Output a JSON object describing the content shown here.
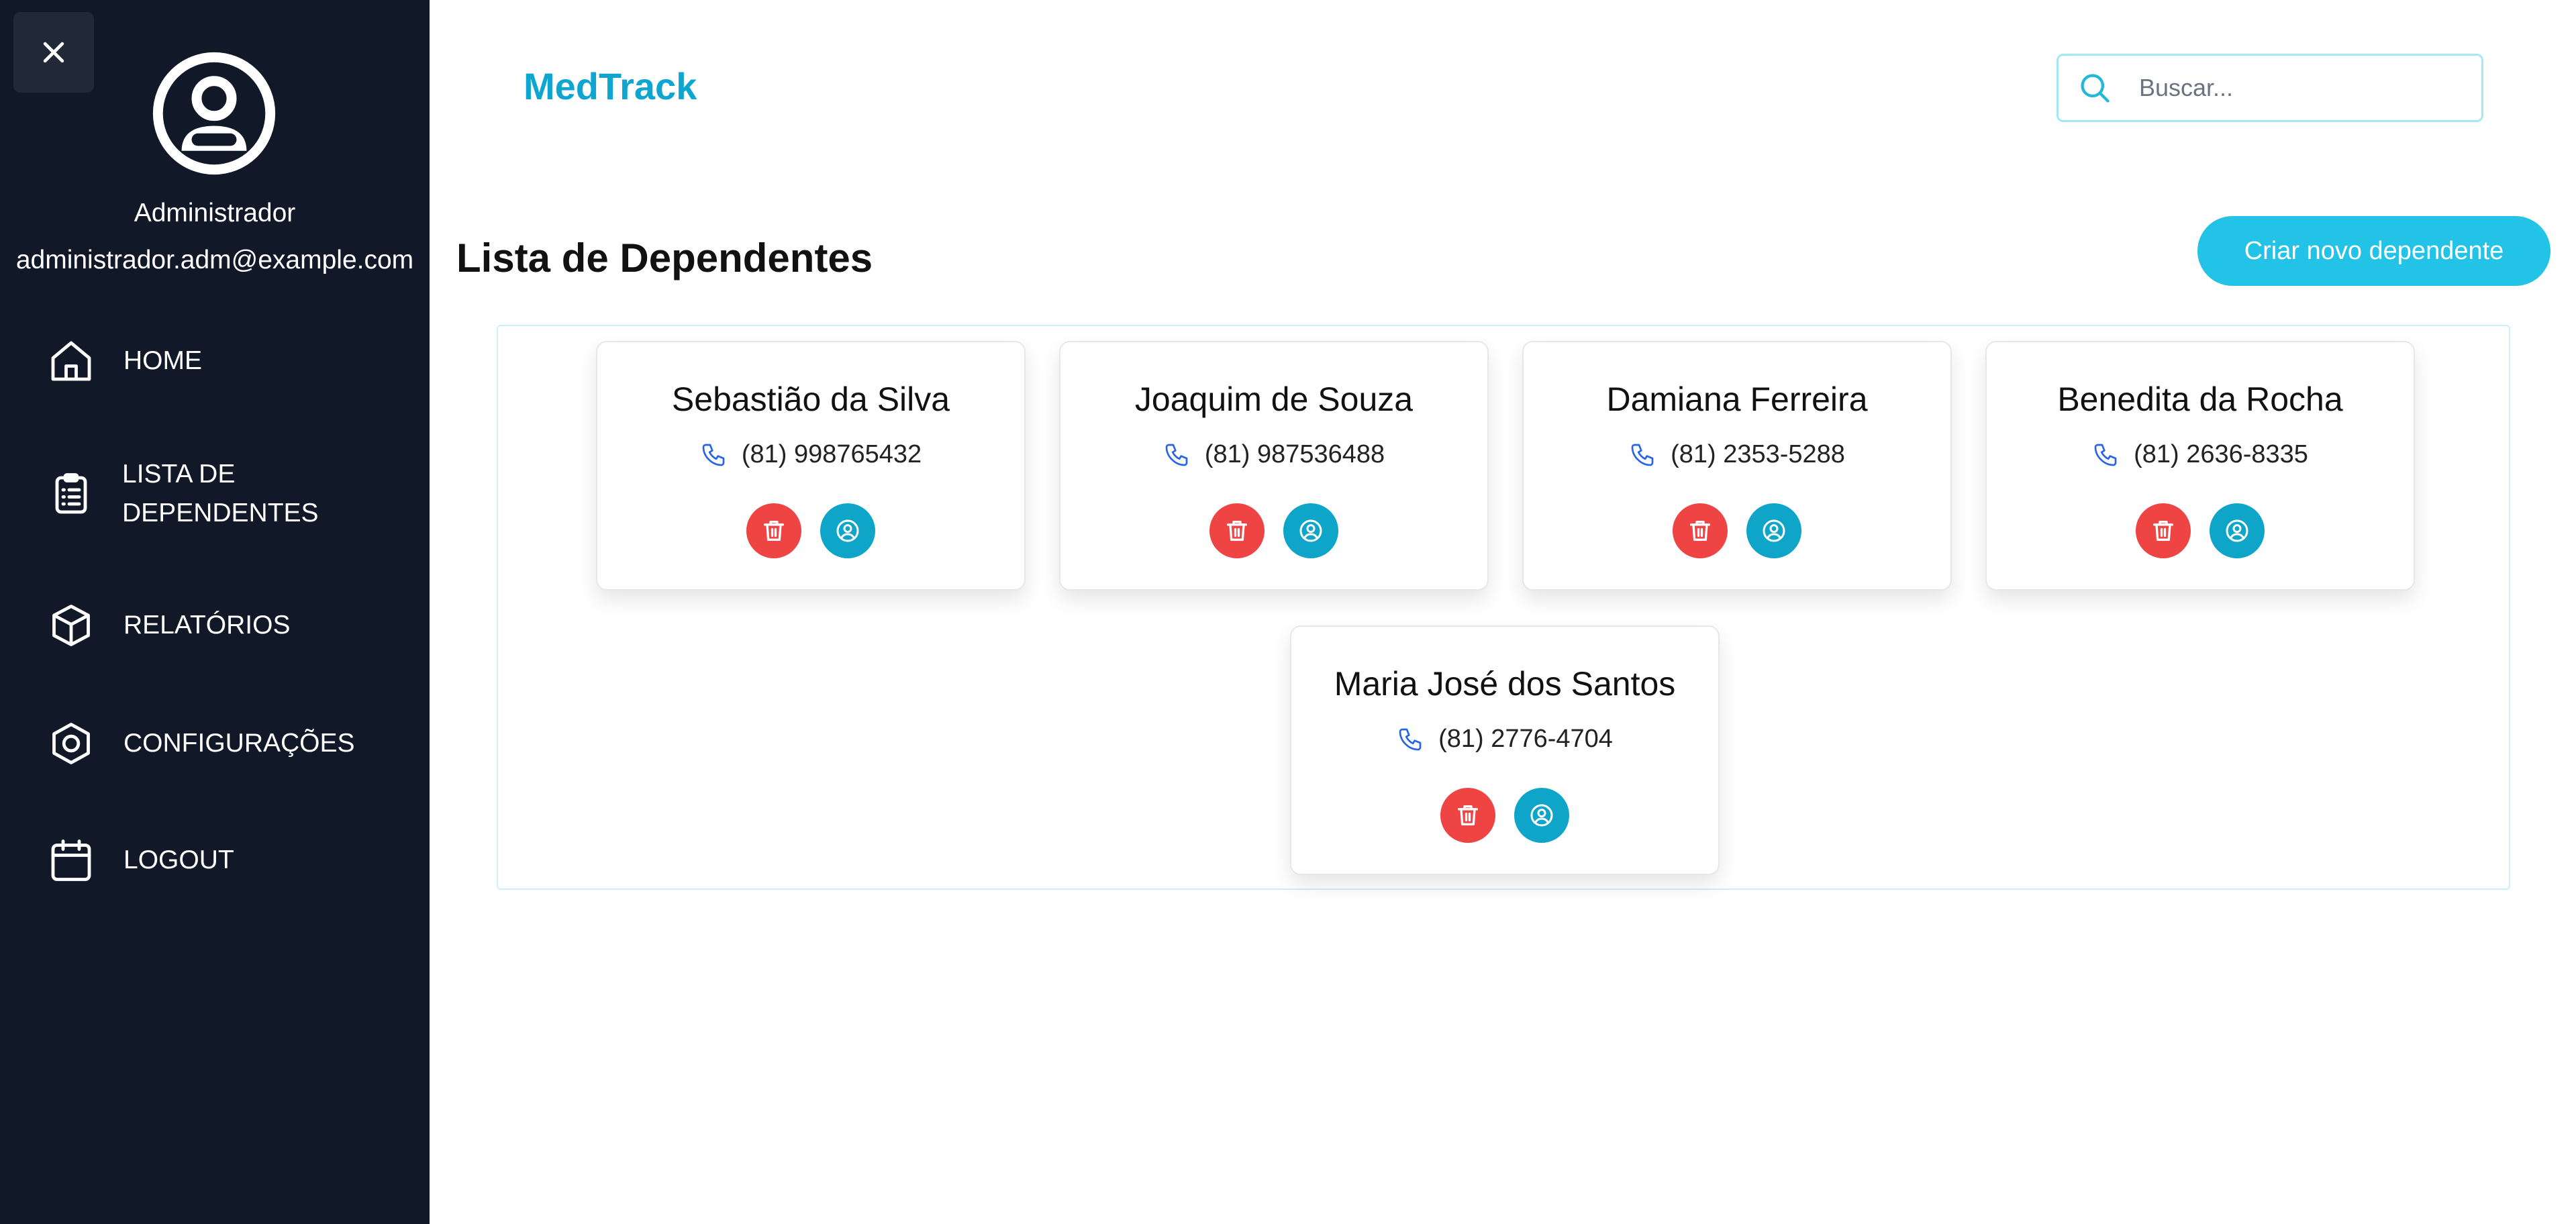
{
  "sidebar": {
    "close_icon": "close-icon",
    "avatar_icon": "user-circle-icon",
    "user_name": "Administrador",
    "user_email": "administrador.adm@example.com",
    "nav": [
      {
        "label": "HOME",
        "icon": "home-icon"
      },
      {
        "label": "LISTA DE DEPENDENTES",
        "icon": "clipboard-list-icon"
      },
      {
        "label": "RELATÓRIOS",
        "icon": "cube-icon"
      },
      {
        "label": "CONFIGURAÇÕES",
        "icon": "hexagon-settings-icon"
      },
      {
        "label": "LOGOUT",
        "icon": "calendar-icon"
      }
    ]
  },
  "header": {
    "brand": "MedTrack",
    "search_placeholder": "Buscar..."
  },
  "main": {
    "title": "Lista de Dependentes",
    "create_button": "Criar novo dependente",
    "dependents": [
      {
        "name": "Sebastião da Silva",
        "phone": "(81) 998765432"
      },
      {
        "name": "Joaquim de Souza",
        "phone": "(81) 987536488"
      },
      {
        "name": "Damiana Ferreira",
        "phone": "(81) 2353-5288"
      },
      {
        "name": "Benedita da Rocha",
        "phone": "(81) 2636-8335"
      },
      {
        "name": "Maria José dos Santos",
        "phone": "(81) 2776-4704"
      }
    ]
  },
  "colors": {
    "sidebar_bg": "#111827",
    "brand": "#0ea5d0",
    "primary_button": "#22c3e6",
    "delete_button": "#ef4444",
    "profile_button": "#0ea5c9",
    "phone_icon": "#2563eb"
  }
}
